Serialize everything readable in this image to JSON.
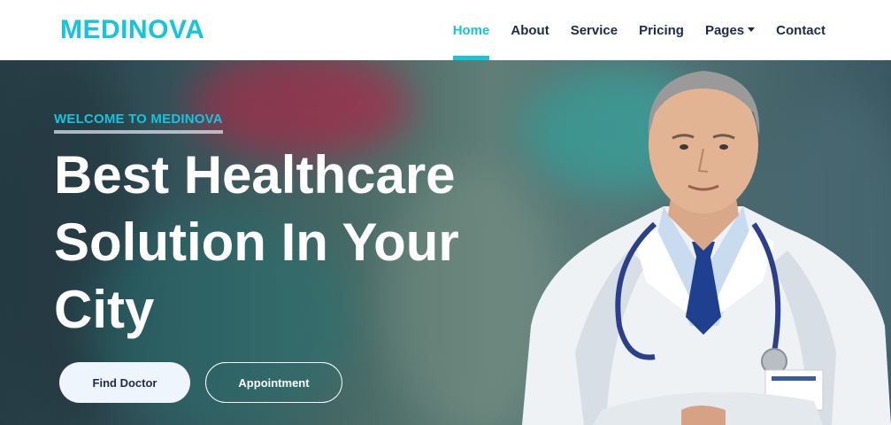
{
  "brand": {
    "name": "MEDINOVA",
    "color": "#13C5DD"
  },
  "nav": {
    "items": [
      {
        "label": "Home",
        "active": true
      },
      {
        "label": "About",
        "active": false
      },
      {
        "label": "Service",
        "active": false
      },
      {
        "label": "Pricing",
        "active": false
      },
      {
        "label": "Pages",
        "active": false,
        "dropdown": true
      },
      {
        "label": "Contact",
        "active": false
      }
    ]
  },
  "hero": {
    "eyebrow": "WELCOME TO MEDINOVA",
    "headline": "Best Healthcare Solution In Your City",
    "buttons": {
      "find_doctor": "Find Doctor",
      "appointment": "Appointment"
    },
    "image": "doctor-portrait"
  },
  "colors": {
    "accent": "#13C5DD",
    "dark": "#1D2A4D",
    "light_button": "#EEF5FC"
  }
}
